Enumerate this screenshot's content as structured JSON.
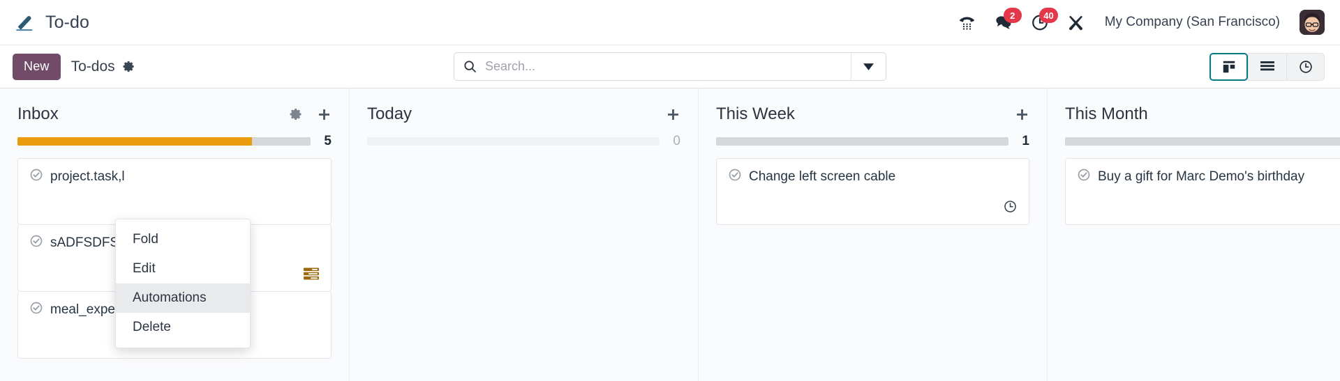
{
  "navbar": {
    "app_title": "To-do",
    "app_icon": "pencil-icon",
    "icons": [
      {
        "name": "dialpad-phone-icon",
        "badge": null
      },
      {
        "name": "chat-bubbles-icon",
        "badge": "2"
      },
      {
        "name": "clock-activities-icon",
        "badge": "40"
      },
      {
        "name": "tools-wrench-icon",
        "badge": null
      }
    ],
    "company": "My Company (San Francisco)",
    "avatar": "user-avatar"
  },
  "control_panel": {
    "new_label": "New",
    "breadcrumb": "To-dos",
    "breadcrumb_gear_icon": "gear-icon",
    "search": {
      "placeholder": "Search...",
      "value": "",
      "icon": "search-icon",
      "toggle_icon": "chevron-down-icon"
    },
    "views": [
      {
        "name": "kanban-view",
        "icon": "kanban-icon",
        "active": true
      },
      {
        "name": "list-view",
        "icon": "list-icon",
        "active": false
      },
      {
        "name": "activity-view",
        "icon": "clock-icon",
        "active": false
      }
    ]
  },
  "columns": [
    {
      "title": "Inbox",
      "count": "5",
      "count_muted": false,
      "has_gear": true,
      "progress": [
        {
          "color": "#E99D0E",
          "pct": 80
        },
        {
          "color": "#D5D7DA",
          "pct": 20
        }
      ],
      "cards": [
        {
          "title": "project.task,l",
          "footer_icon": null
        },
        {
          "title": "sADFSDFSDF",
          "footer_icon": "activity-lines-icon"
        },
        {
          "title": "meal_expense.png",
          "footer_icon": null
        }
      ]
    },
    {
      "title": "Today",
      "count": "0",
      "count_muted": true,
      "has_gear": false,
      "progress": [
        {
          "color": "#F0F1F3",
          "pct": 100
        }
      ],
      "cards": []
    },
    {
      "title": "This Week",
      "count": "1",
      "count_muted": false,
      "has_gear": false,
      "progress": [
        {
          "color": "#D5D7DA",
          "pct": 100
        }
      ],
      "cards": [
        {
          "title": "Change left screen cable",
          "footer_icon": "clock-icon"
        }
      ]
    },
    {
      "title": "This Month",
      "count": "",
      "count_muted": false,
      "has_gear": false,
      "progress": [
        {
          "color": "#D5D7DA",
          "pct": 100
        }
      ],
      "cards": [
        {
          "title": "Buy a gift for Marc Demo's birthday",
          "footer_icon": "clock-icon"
        }
      ]
    }
  ],
  "dropdown": {
    "items": [
      {
        "label": "Fold",
        "hover": false
      },
      {
        "label": "Edit",
        "hover": false
      },
      {
        "label": "Automations",
        "hover": true
      },
      {
        "label": "Delete",
        "hover": false
      }
    ]
  },
  "colors": {
    "brand_purple": "#714B67",
    "badge_red": "#E4384A",
    "progress_orange": "#E99D0E",
    "activity_amber": "#996B0E",
    "active_view_border": "#017E84"
  }
}
